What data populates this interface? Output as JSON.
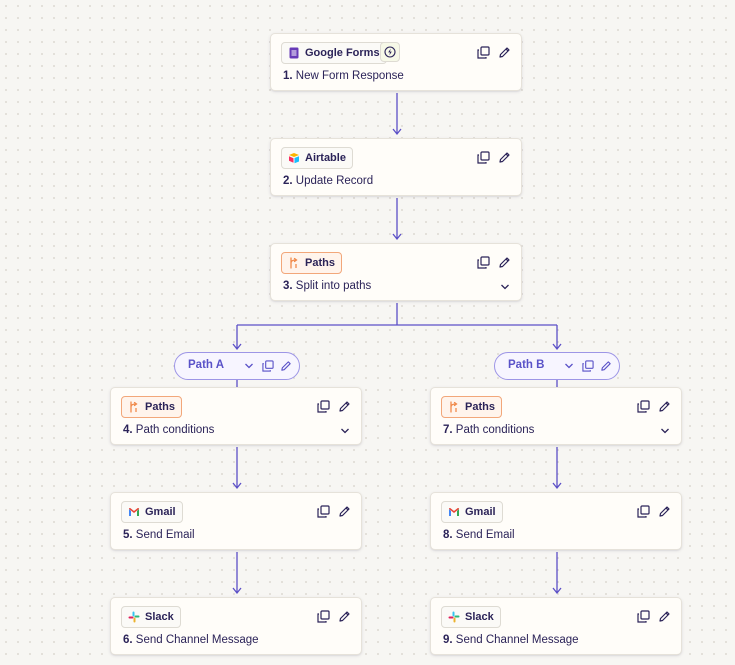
{
  "trigger": {
    "app": "Google Forms",
    "step_number": "1.",
    "step_title": "New Form Response"
  },
  "steps": [
    {
      "app": "Airtable",
      "step_number": "2.",
      "step_title": "Update Record"
    },
    {
      "app": "Paths",
      "step_number": "3.",
      "step_title": "Split into paths"
    }
  ],
  "paths": [
    {
      "label": "Path A",
      "steps": [
        {
          "app": "Paths",
          "step_number": "4.",
          "step_title": "Path conditions"
        },
        {
          "app": "Gmail",
          "step_number": "5.",
          "step_title": "Send Email"
        },
        {
          "app": "Slack",
          "step_number": "6.",
          "step_title": "Send Channel Message"
        }
      ]
    },
    {
      "label": "Path B",
      "steps": [
        {
          "app": "Paths",
          "step_number": "7.",
          "step_title": "Path conditions"
        },
        {
          "app": "Gmail",
          "step_number": "8.",
          "step_title": "Send Email"
        },
        {
          "app": "Slack",
          "step_number": "9.",
          "step_title": "Send Channel Message"
        }
      ]
    }
  ],
  "colors": {
    "connector": "#5b4fc7",
    "paths_accent": "#f08a4b",
    "pill_border": "#9d95e6",
    "text": "#2b2358"
  },
  "icons": {
    "copy": "duplicate-icon",
    "edit": "pencil-icon",
    "chevron": "chevron-down-icon",
    "trigger_extra": "lightning-icon"
  }
}
